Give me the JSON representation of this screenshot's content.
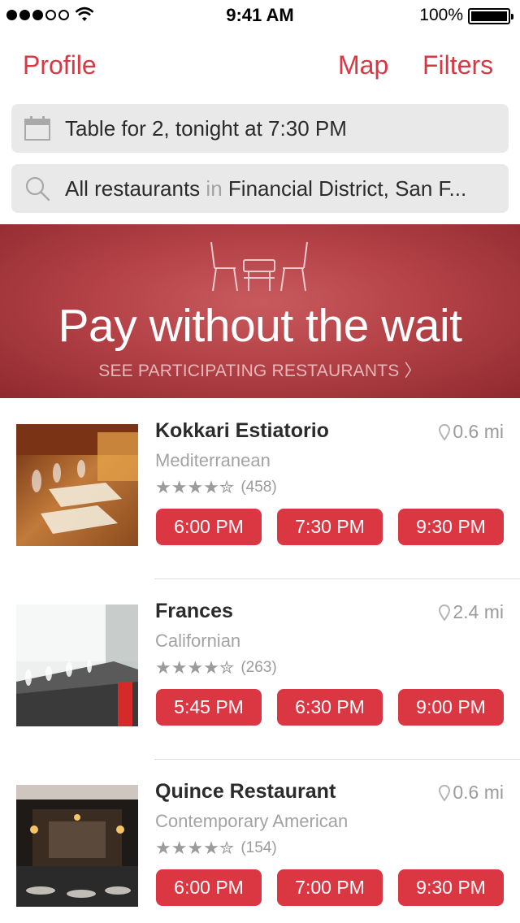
{
  "status_bar": {
    "time": "9:41 AM",
    "battery": "100%"
  },
  "nav": {
    "profile": "Profile",
    "map": "Map",
    "filters": "Filters"
  },
  "reservation": {
    "text": "Table for 2, tonight at 7:30 PM"
  },
  "search": {
    "prefix": "All restaurants",
    "joiner": "in",
    "location": "Financial District, San F..."
  },
  "promo": {
    "title": "Pay without the wait",
    "link": "SEE PARTICIPATING RESTAURANTS",
    "chevron": "〉"
  },
  "icons": {
    "calendar": "calendar-icon",
    "search": "search-icon",
    "location": "location-pin-icon",
    "star": "star-icon"
  },
  "colors": {
    "accent": "#da3743",
    "promo": "#b44247",
    "bar_bg": "#e9e9e9"
  },
  "restaurants": [
    {
      "name": "Kokkari Estiatorio",
      "distance": "0.6 mi",
      "cuisine": "Mediterranean",
      "stars": "★★★★✮",
      "reviews": "(458)",
      "times": [
        "6:00 PM",
        "7:30 PM",
        "9:30 PM"
      ]
    },
    {
      "name": "Frances",
      "distance": "2.4 mi",
      "cuisine": "Californian",
      "stars": "★★★★✮",
      "reviews": "(263)",
      "times": [
        "5:45 PM",
        "6:30 PM",
        "9:00 PM"
      ]
    },
    {
      "name": "Quince Restaurant",
      "distance": "0.6 mi",
      "cuisine": "Contemporary American",
      "stars": "★★★★✮",
      "reviews": "(154)",
      "times": [
        "6:00 PM",
        "7:00 PM",
        "9:30 PM"
      ]
    }
  ]
}
